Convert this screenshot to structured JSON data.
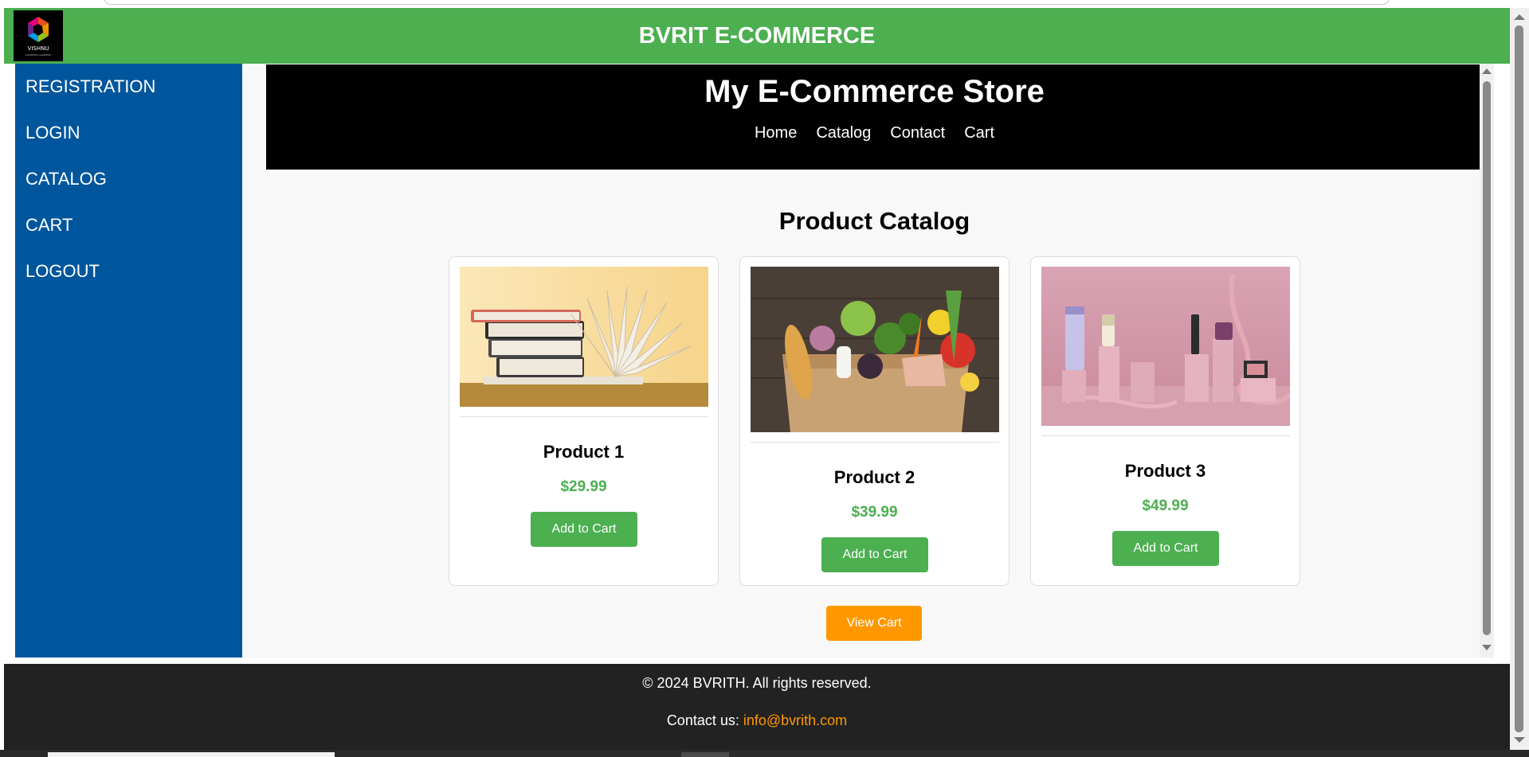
{
  "header": {
    "title": "BVRIT E-COMMERCE",
    "logo_text": "VISHNU",
    "logo_subtext": "UNIVERSAL LEARNING",
    "accent_color": "#4caf50"
  },
  "sidebar": {
    "items": [
      {
        "label": "REGISTRATION"
      },
      {
        "label": "LOGIN"
      },
      {
        "label": "CATALOG"
      },
      {
        "label": "CART"
      },
      {
        "label": "LOGOUT"
      }
    ],
    "color": "#00569c"
  },
  "store": {
    "title": "My E-Commerce Store",
    "nav": [
      {
        "label": "Home"
      },
      {
        "label": "Catalog"
      },
      {
        "label": "Contact"
      },
      {
        "label": "Cart"
      }
    ]
  },
  "catalog": {
    "heading": "Product Catalog",
    "products": [
      {
        "name": "Product 1",
        "price": "$29.99",
        "button": "Add to Cart",
        "image": "books-image"
      },
      {
        "name": "Product 2",
        "price": "$39.99",
        "button": "Add to Cart",
        "image": "groceries-image"
      },
      {
        "name": "Product 3",
        "price": "$49.99",
        "button": "Add to Cart",
        "image": "cosmetics-image"
      }
    ],
    "view_cart": "View Cart"
  },
  "footer": {
    "copyright": "© 2024 BVRITH. All rights reserved.",
    "contact_label": "Contact us: ",
    "contact_email": "info@bvrith.com"
  }
}
